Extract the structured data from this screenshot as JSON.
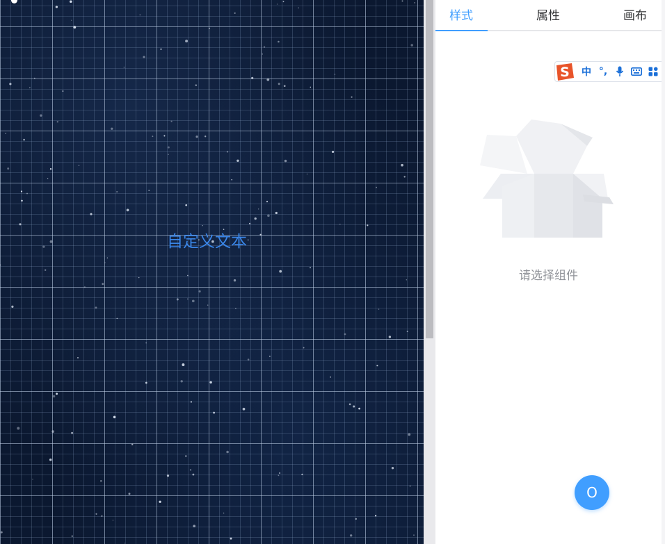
{
  "canvas": {
    "custom_text": "自定义文本",
    "text_color": "#3a86e8",
    "background_color": "#0b1830"
  },
  "panel": {
    "tabs": [
      {
        "label": "样式",
        "active": true
      },
      {
        "label": "属性",
        "active": false
      },
      {
        "label": "画布",
        "active": false
      }
    ],
    "empty_text": "请选择组件",
    "float_button_label": "O",
    "accent_color": "#409eff"
  },
  "ime_toolbar": {
    "logo_letter": "S",
    "mode_label": "中",
    "punct_label": "°,",
    "items": [
      "sogou-logo-icon",
      "chinese-mode",
      "punctuation-mode",
      "microphone-icon",
      "keyboard-icon",
      "grid-menu-icon"
    ]
  }
}
